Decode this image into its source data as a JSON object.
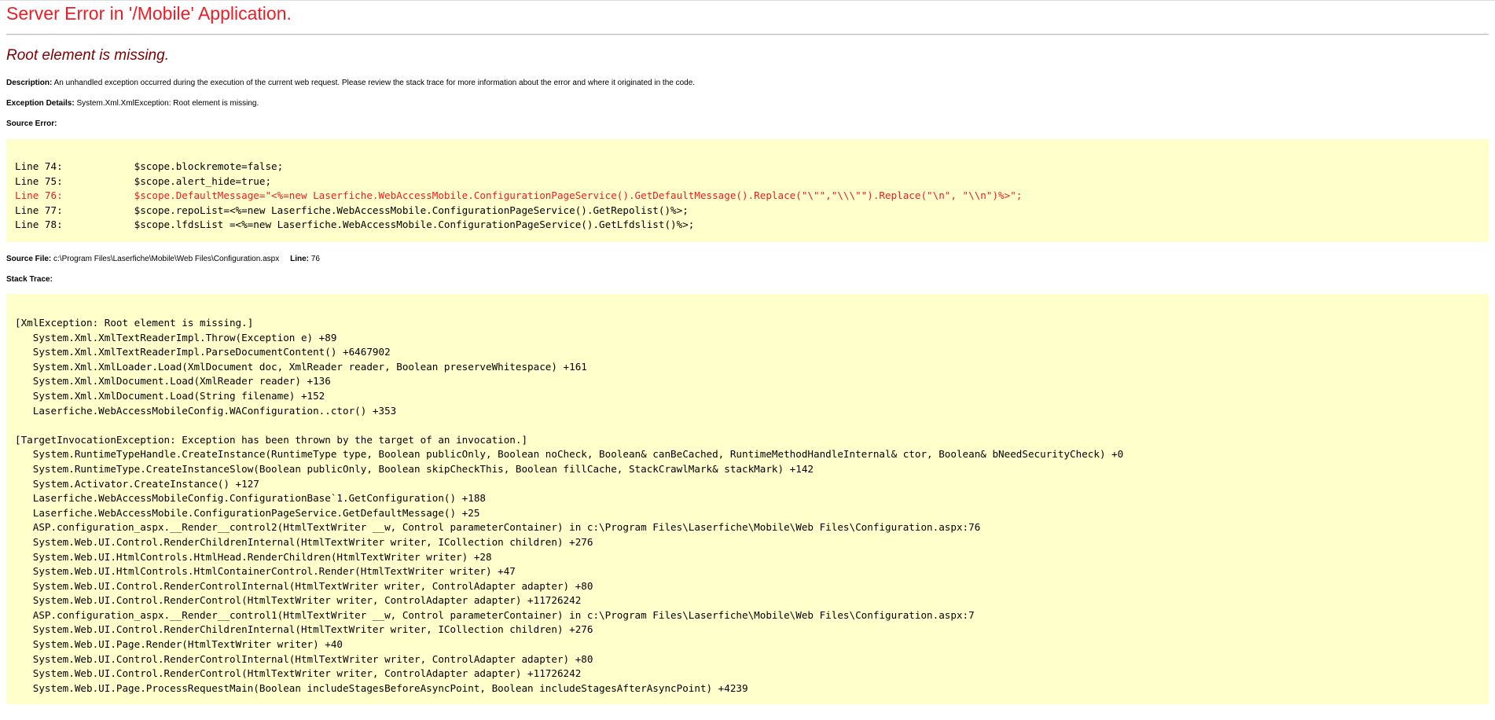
{
  "page": {
    "title": "Server Error in '/Mobile' Application.",
    "message": "Root element is missing."
  },
  "description": {
    "label": "Description:",
    "text": "An unhandled exception occurred during the execution of the current web request. Please review the stack trace for more information about the error and where it originated in the code."
  },
  "exception": {
    "label": "Exception Details:",
    "text": "System.Xml.XmlException: Root element is missing."
  },
  "source_error": {
    "label": "Source Error:",
    "lines": [
      {
        "text": "Line 74:            $scope.blockremote=false;",
        "highlight": false
      },
      {
        "text": "Line 75:            $scope.alert_hide=true;",
        "highlight": false
      },
      {
        "text": "Line 76:            $scope.DefaultMessage=\"<%=new Laserfiche.WebAccessMobile.ConfigurationPageService().GetDefaultMessage().Replace(\"\\\"\",\"\\\\\\\"\").Replace(\"\\n\", \"\\\\n\")%>\";",
        "highlight": true
      },
      {
        "text": "Line 77:            $scope.repoList=<%=new Laserfiche.WebAccessMobile.ConfigurationPageService().GetRepolist()%>;",
        "highlight": false
      },
      {
        "text": "Line 78:            $scope.lfdsList =<%=new Laserfiche.WebAccessMobile.ConfigurationPageService().GetLfdslist()%>;",
        "highlight": false
      }
    ]
  },
  "source_file": {
    "label": "Source File:",
    "path": "c:\\Program Files\\Laserfiche\\Mobile\\Web Files\\Configuration.aspx",
    "line_label": "Line:",
    "line_value": "76"
  },
  "stack_trace": {
    "label": "Stack Trace:",
    "lines": [
      "[XmlException: Root element is missing.]",
      "   System.Xml.XmlTextReaderImpl.Throw(Exception e) +89",
      "   System.Xml.XmlTextReaderImpl.ParseDocumentContent() +6467902",
      "   System.Xml.XmlLoader.Load(XmlDocument doc, XmlReader reader, Boolean preserveWhitespace) +161",
      "   System.Xml.XmlDocument.Load(XmlReader reader) +136",
      "   System.Xml.XmlDocument.Load(String filename) +152",
      "   Laserfiche.WebAccessMobileConfig.WAConfiguration..ctor() +353",
      "",
      "[TargetInvocationException: Exception has been thrown by the target of an invocation.]",
      "   System.RuntimeTypeHandle.CreateInstance(RuntimeType type, Boolean publicOnly, Boolean noCheck, Boolean& canBeCached, RuntimeMethodHandleInternal& ctor, Boolean& bNeedSecurityCheck) +0",
      "   System.RuntimeType.CreateInstanceSlow(Boolean publicOnly, Boolean skipCheckThis, Boolean fillCache, StackCrawlMark& stackMark) +142",
      "   System.Activator.CreateInstance() +127",
      "   Laserfiche.WebAccessMobileConfig.ConfigurationBase`1.GetConfiguration() +188",
      "   Laserfiche.WebAccessMobile.ConfigurationPageService.GetDefaultMessage() +25",
      "   ASP.configuration_aspx.__Render__control2(HtmlTextWriter __w, Control parameterContainer) in c:\\Program Files\\Laserfiche\\Mobile\\Web Files\\Configuration.aspx:76",
      "   System.Web.UI.Control.RenderChildrenInternal(HtmlTextWriter writer, ICollection children) +276",
      "   System.Web.UI.HtmlControls.HtmlHead.RenderChildren(HtmlTextWriter writer) +28",
      "   System.Web.UI.HtmlControls.HtmlContainerControl.Render(HtmlTextWriter writer) +47",
      "   System.Web.UI.Control.RenderControlInternal(HtmlTextWriter writer, ControlAdapter adapter) +80",
      "   System.Web.UI.Control.RenderControl(HtmlTextWriter writer, ControlAdapter adapter) +11726242",
      "   ASP.configuration_aspx.__Render__control1(HtmlTextWriter __w, Control parameterContainer) in c:\\Program Files\\Laserfiche\\Mobile\\Web Files\\Configuration.aspx:7",
      "   System.Web.UI.Control.RenderChildrenInternal(HtmlTextWriter writer, ICollection children) +276",
      "   System.Web.UI.Page.Render(HtmlTextWriter writer) +40",
      "   System.Web.UI.Control.RenderControlInternal(HtmlTextWriter writer, ControlAdapter adapter) +80",
      "   System.Web.UI.Control.RenderControl(HtmlTextWriter writer, ControlAdapter adapter) +11726242",
      "   System.Web.UI.Page.ProcessRequestMain(Boolean includeStagesBeforeAsyncPoint, Boolean includeStagesAfterAsyncPoint) +4239"
    ]
  },
  "colors": {
    "title": "#ee1c24",
    "message": "#800000",
    "code_background": "#ffffcc",
    "highlight_line": "#ee1c24"
  }
}
